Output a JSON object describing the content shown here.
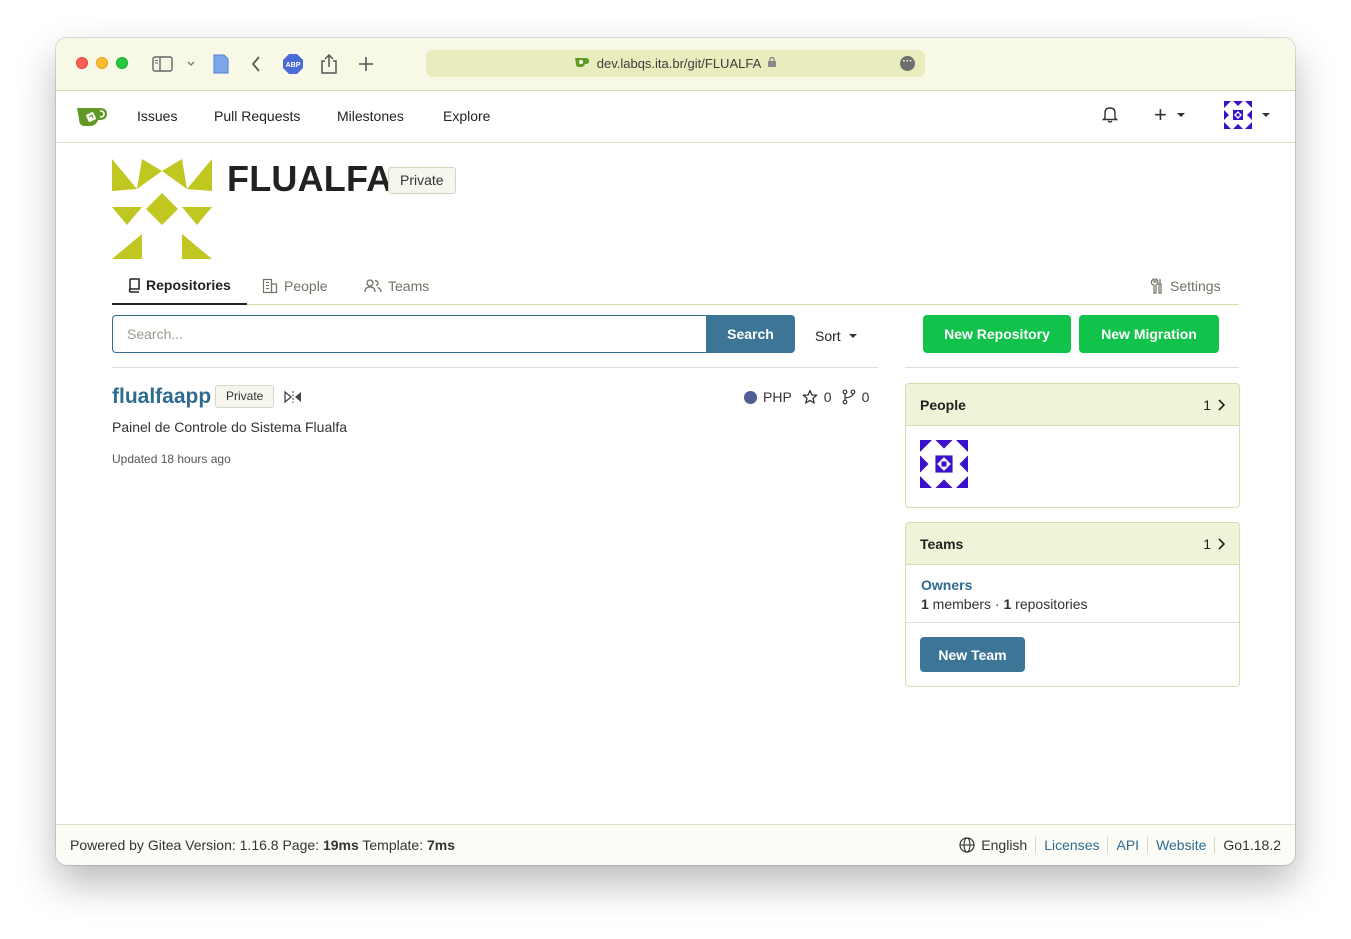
{
  "browser": {
    "url": "dev.labqs.ita.br/git/FLUALFA"
  },
  "nav": {
    "issues": "Issues",
    "pull_requests": "Pull Requests",
    "milestones": "Milestones",
    "explore": "Explore",
    "plus": "+"
  },
  "org": {
    "name": "FLUALFA",
    "visibility": "Private"
  },
  "tabs": {
    "repositories": "Repositories",
    "people": "People",
    "teams": "Teams",
    "settings": "Settings"
  },
  "search": {
    "placeholder": "Search...",
    "button": "Search",
    "sort": "Sort"
  },
  "actions": {
    "new_repository": "New Repository",
    "new_migration": "New Migration"
  },
  "repos": [
    {
      "name": "flualfaapp",
      "visibility": "Private",
      "language": "PHP",
      "stars": "0",
      "forks": "0",
      "description": "Painel de Controle do Sistema Flualfa",
      "updated": "Updated 18 hours ago"
    }
  ],
  "people_card": {
    "title": "People",
    "count": "1"
  },
  "teams_card": {
    "title": "Teams",
    "count": "1",
    "team_name": "Owners",
    "members_count": "1",
    "members_label": " members · ",
    "repos_count": "1",
    "repos_label": " repositories",
    "new_team": "New Team"
  },
  "footer": {
    "powered_prefix": "Powered by Gitea Version: 1.16.8 Page: ",
    "page_time": "19ms",
    "template_prefix": " Template: ",
    "template_time": "7ms",
    "language": "English",
    "licenses": "Licenses",
    "api": "API",
    "website": "Website",
    "go_version": "Go1.18.2"
  },
  "colors": {
    "brand_green": "#11c34a",
    "link_blue": "#2f6c90",
    "button_blue": "#3c7596",
    "avatar_lime": "#c0c720",
    "user_avatar_blue": "#3a10c8",
    "php_color": "#4f5d95"
  }
}
